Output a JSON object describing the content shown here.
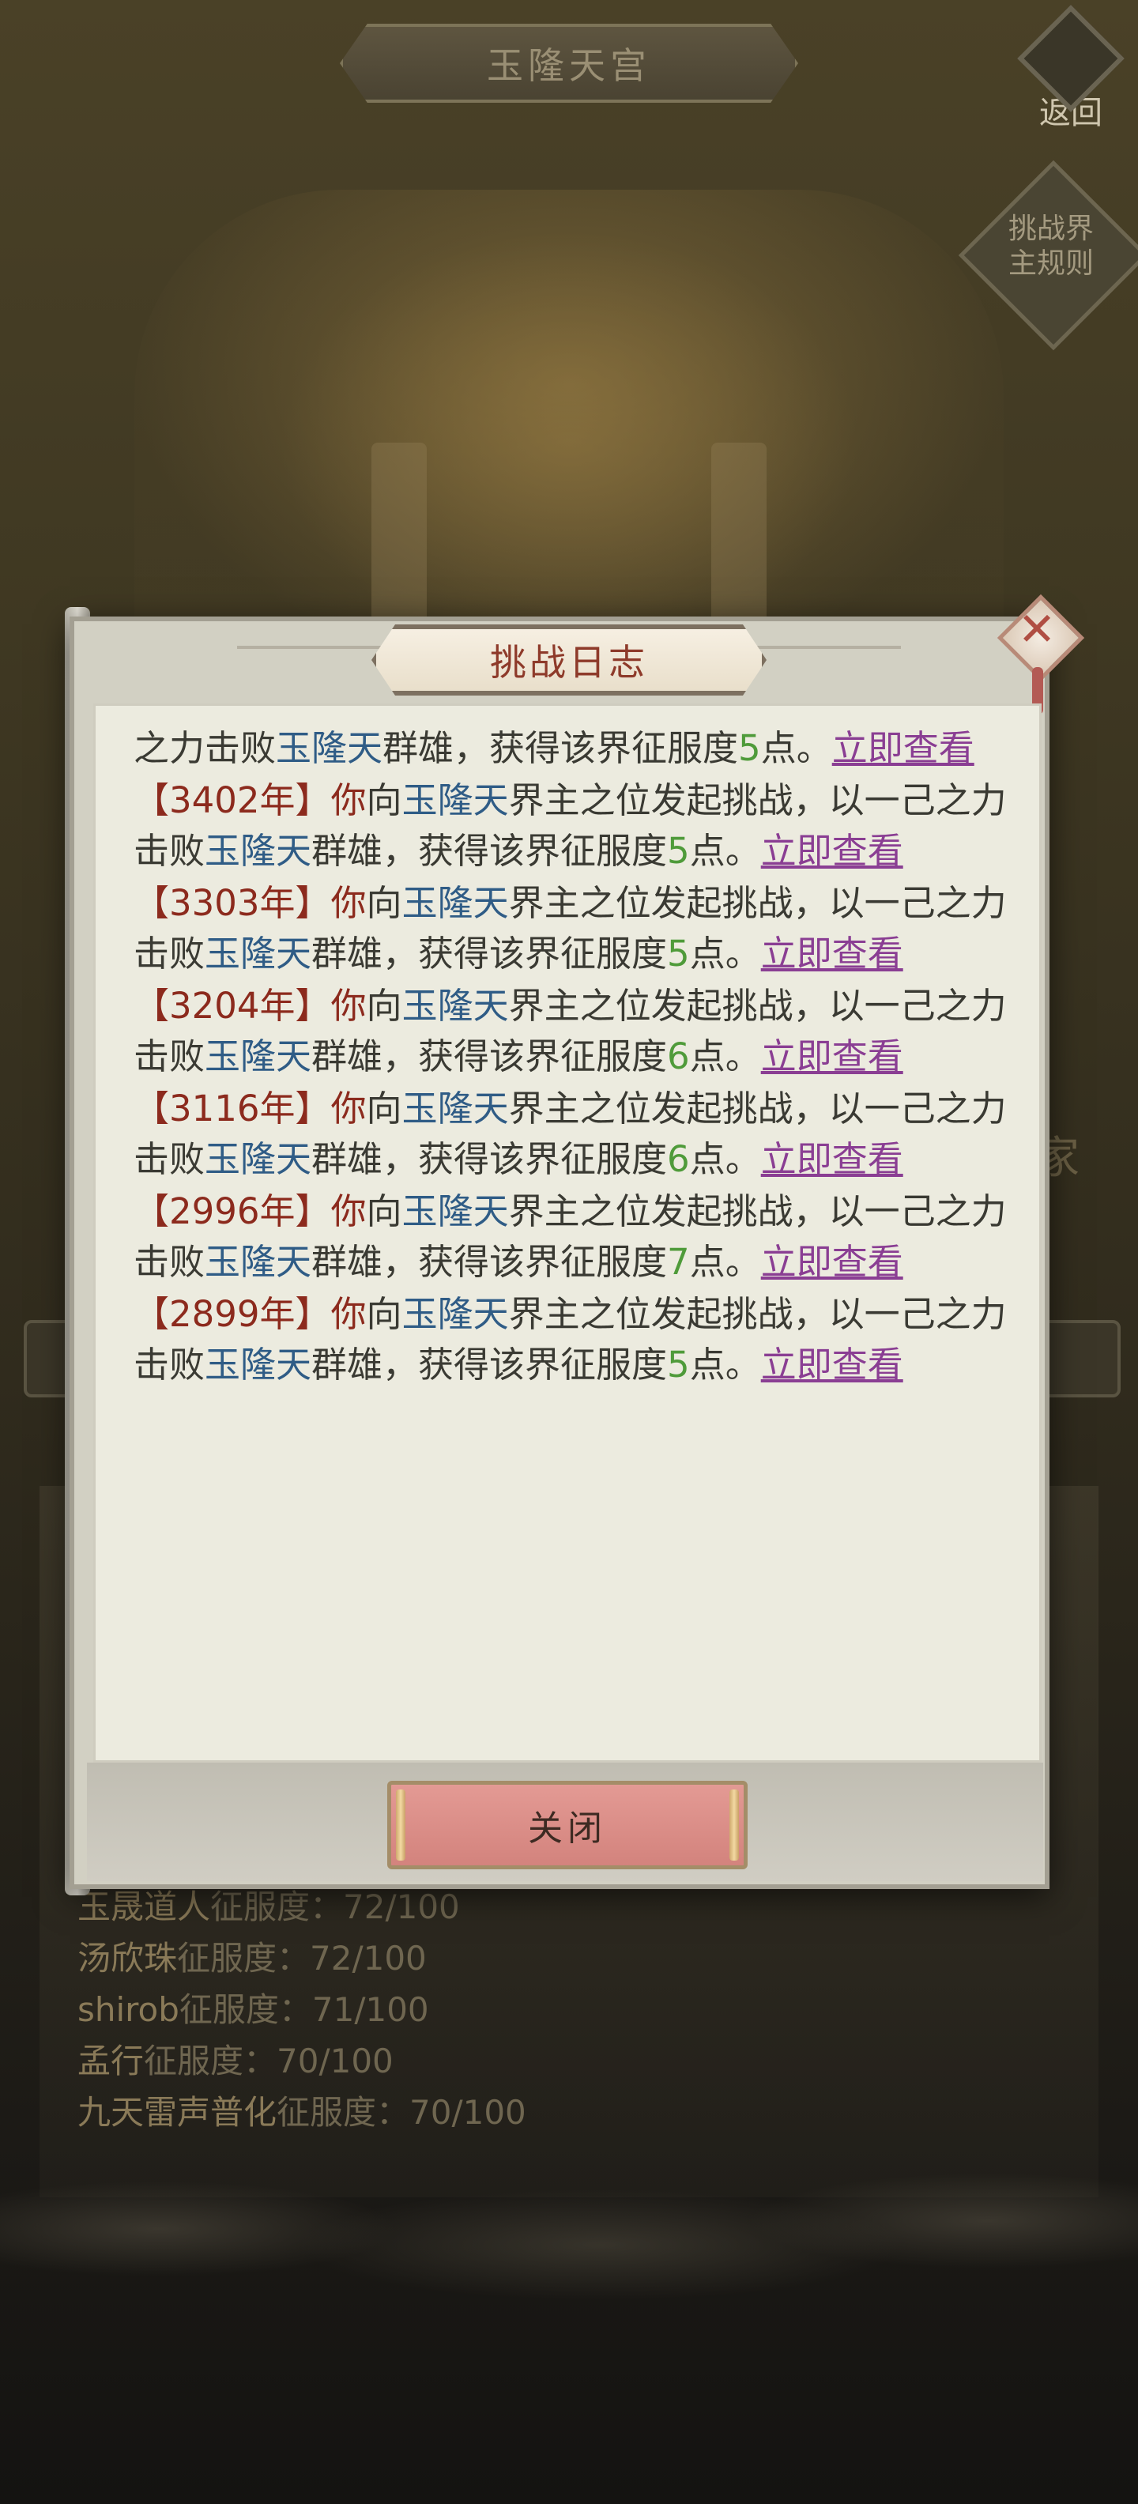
{
  "background": {
    "title": "玉隆天宫",
    "back_label": "返回",
    "rules_label_line1": "挑战界",
    "rules_label_line2": "主规则",
    "right_edge_char": "家",
    "conquest_list": [
      {
        "name": "玉晟道人",
        "suffix": "征服度：72/100"
      },
      {
        "name": "汤欣珠",
        "suffix": "征服度：72/100"
      },
      {
        "name": "shirob",
        "suffix": "征服度：71/100"
      },
      {
        "name": "孟行",
        "suffix": "征服度：70/100"
      },
      {
        "name": "九天雷声普化",
        "suffix": "征服度：70/100"
      }
    ]
  },
  "dialog": {
    "title": "挑战日志",
    "close_button": "关闭",
    "first_entry_partial": {
      "prefix": "之力击败",
      "realm": "玉隆天",
      "mid": "群雄，获得该界征服度",
      "points": "5",
      "suffix": "点。",
      "link": "立即查看"
    },
    "entries": [
      {
        "year": "【3402年】",
        "you": "你",
        "to": "向",
        "realm": "玉隆天",
        "text1": "界主之位发起挑战，以一己之力击败",
        "realm2": "玉隆天",
        "text2": "群雄，获得该界征服度",
        "points": "5",
        "text3": "点。",
        "link": "立即查看"
      },
      {
        "year": "【3303年】",
        "you": "你",
        "to": "向",
        "realm": "玉隆天",
        "text1": "界主之位发起挑战，以一己之力击败",
        "realm2": "玉隆天",
        "text2": "群雄，获得该界征服度",
        "points": "5",
        "text3": "点。",
        "link": "立即查看"
      },
      {
        "year": "【3204年】",
        "you": "你",
        "to": "向",
        "realm": "玉隆天",
        "text1": "界主之位发起挑战，以一己之力击败",
        "realm2": "玉隆天",
        "text2": "群雄，获得该界征服度",
        "points": "6",
        "text3": "点。",
        "link": "立即查看"
      },
      {
        "year": "【3116年】",
        "you": "你",
        "to": "向",
        "realm": "玉隆天",
        "text1": "界主之位发起挑战，以一己之力击败",
        "realm2": "玉隆天",
        "text2": "群雄，获得该界征服度",
        "points": "6",
        "text3": "点。",
        "link": "立即查看"
      },
      {
        "year": "【2996年】",
        "you": "你",
        "to": "向",
        "realm": "玉隆天",
        "text1": "界主之位发起挑战，以一己之力击败",
        "realm2": "玉隆天",
        "text2": "群雄，获得该界征服度",
        "points": "7",
        "text3": "点。",
        "link": "立即查看"
      },
      {
        "year": "【2899年】",
        "you": "你",
        "to": "向",
        "realm": "玉隆天",
        "text1": "界主之位发起挑战，以一己之力击败",
        "realm2": "玉隆天",
        "text2": "群雄，获得该界征服度",
        "points": "5",
        "text3": "点。",
        "link": "立即查看"
      }
    ]
  },
  "colors": {
    "year": "#8c2a1d",
    "realm": "#2f5c86",
    "points": "#4f9b3a",
    "link": "#8a3e93",
    "close_button": "#d98a84"
  },
  "icons": {
    "close": "close-x-icon",
    "back": "back-arrow-icon"
  }
}
